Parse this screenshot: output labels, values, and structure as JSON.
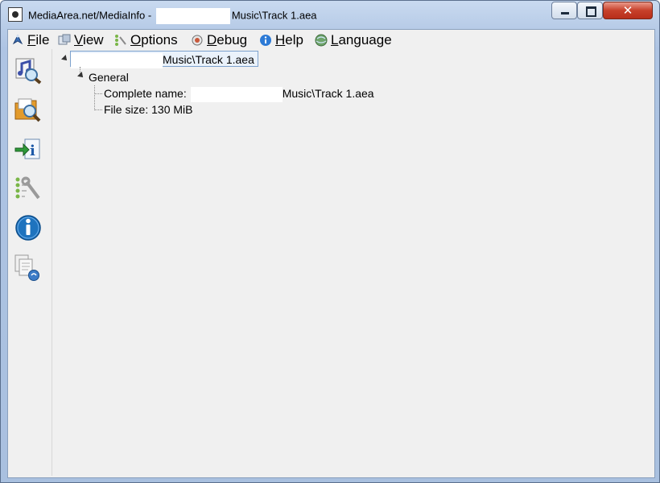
{
  "window": {
    "title_prefix": "MediaArea.net/MediaInfo - ",
    "title_suffix": "Music\\Track 1.aea",
    "close_glyph": "✕"
  },
  "menu": {
    "items": [
      {
        "label": "File",
        "icon": "file-icon"
      },
      {
        "label": "View",
        "icon": "view-icon"
      },
      {
        "label": "Options",
        "icon": "options-icon"
      },
      {
        "label": "Debug",
        "icon": "debug-icon"
      },
      {
        "label": "Help",
        "icon": "help-icon"
      },
      {
        "label": "Language",
        "icon": "globe-icon"
      }
    ]
  },
  "sidebar": {
    "icons": [
      "open-file-icon",
      "open-folder-icon",
      "export-info-icon",
      "preferences-icon",
      "about-info-icon",
      "copy-files-icon"
    ]
  },
  "tree": {
    "root_suffix": "Music\\Track 1.aea",
    "section": "General",
    "complete_name_label": "Complete name:",
    "complete_name_suffix": "Music\\Track 1.aea",
    "file_size": "File size: 130 MiB"
  },
  "colors": {
    "accent": "#1e73be",
    "selection_border": "#7da2ce",
    "close_button": "#c7402a"
  }
}
